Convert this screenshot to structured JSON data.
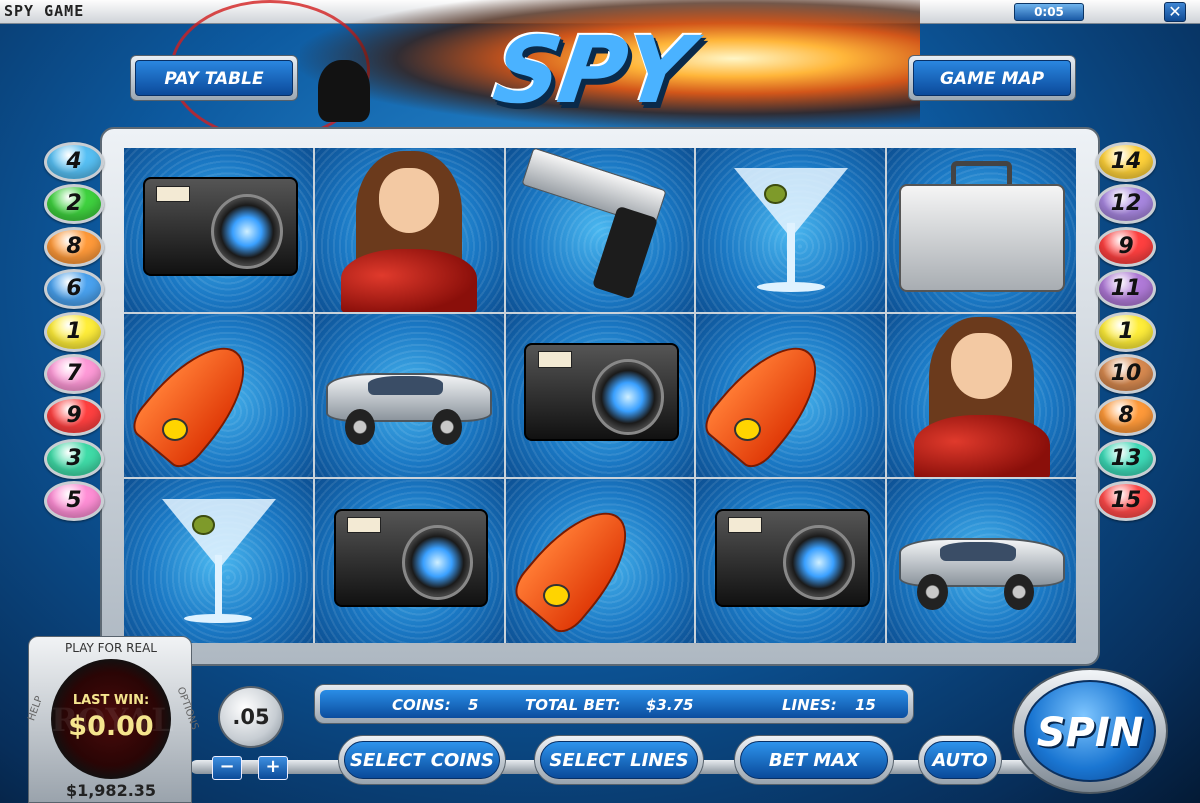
{
  "window": {
    "title": "SPY GAME",
    "timer": "0:05",
    "close": "✕"
  },
  "header": {
    "logo": "SPY GAME",
    "pay_table": "PAY TABLE",
    "game_map": "GAME MAP"
  },
  "paylines": {
    "left": [
      "4",
      "2",
      "8",
      "6",
      "1",
      "7",
      "9",
      "3",
      "5"
    ],
    "right": [
      "14",
      "12",
      "9",
      "11",
      "1",
      "10",
      "8",
      "13",
      "15"
    ],
    "colors": {
      "1": "#ffee3a",
      "2": "#3fd23f",
      "3": "#40dca8",
      "4": "#57c0f4",
      "5": "#ff8fd6",
      "6": "#4aa2ef",
      "7": "#ff9ad8",
      "8": "#ff9a3a",
      "9": "#ff4040",
      "10": "#d88a50",
      "11": "#b07ad8",
      "12": "#a887e0",
      "13": "#3ddbb8",
      "14": "#ffd23a",
      "15": "#ff4a4a"
    }
  },
  "reels": [
    [
      "camera",
      "woman",
      "gun",
      "martini",
      "briefcase"
    ],
    [
      "missile",
      "car",
      "camera",
      "missile",
      "woman"
    ],
    [
      "martini",
      "camera",
      "missile",
      "camera",
      "car"
    ]
  ],
  "info": {
    "coins_label": "COINS:",
    "coins": "5",
    "total_bet_label": "TOTAL BET:",
    "total_bet": "$3.75",
    "lines_label": "LINES:",
    "lines": "15"
  },
  "controls": {
    "coin_value": ".05",
    "minus": "−",
    "plus": "+",
    "select_coins": "SELECT COINS",
    "select_lines": "SELECT LINES",
    "bet_max": "BET MAX",
    "auto": "AUTO",
    "spin": "SPIN"
  },
  "player": {
    "play_for_real": "PLAY FOR REAL",
    "help": "HELP",
    "options": "OPTIONS",
    "brand": "ROYAL",
    "last_win_label": "LAST WIN:",
    "last_win": "$0.00",
    "balance": "$1,982.35"
  }
}
